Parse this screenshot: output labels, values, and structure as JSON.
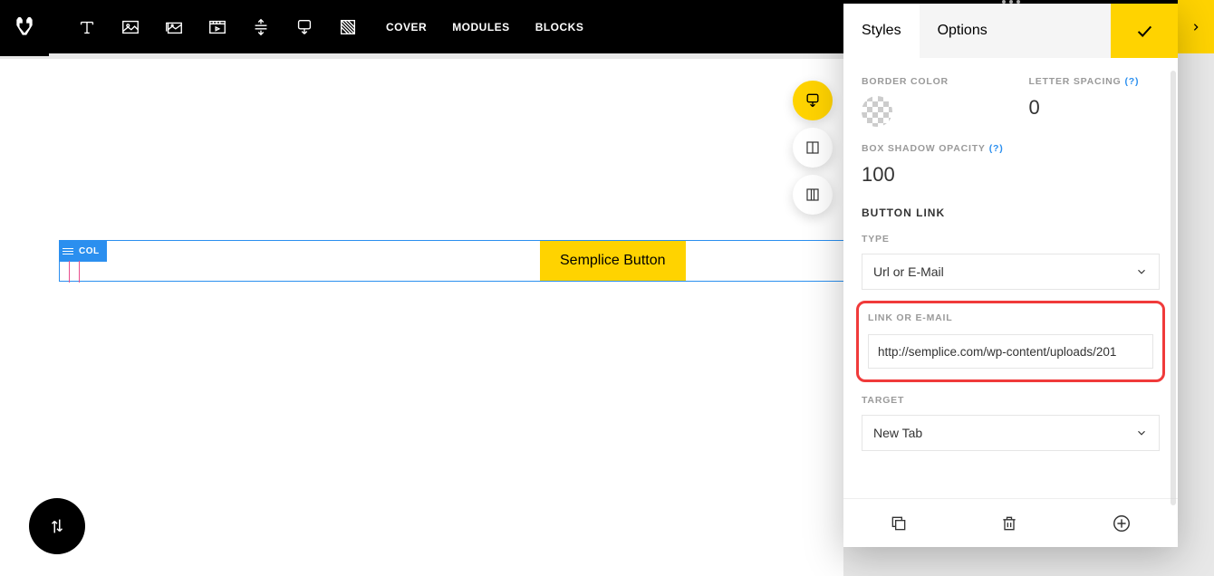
{
  "nav": {
    "cover": "COVER",
    "modules": "MODULES",
    "blocks": "BLOCKS"
  },
  "canvas": {
    "col_label": "COL",
    "button_text": "Semplice Button"
  },
  "panel": {
    "tabs": {
      "styles": "Styles",
      "options": "Options"
    },
    "border_color_label": "BORDER COLOR",
    "letter_spacing_label": "LETTER SPACING",
    "letter_spacing_value": "0",
    "box_shadow_opacity_label": "BOX SHADOW OPACITY",
    "box_shadow_opacity_value": "100",
    "help_marker": "(?)",
    "section_button_link": "BUTTON LINK",
    "type_label": "TYPE",
    "type_value": "Url or E-Mail",
    "link_label": "LINK OR E-MAIL",
    "link_value": "http://semplice.com/wp-content/uploads/201",
    "target_label": "TARGET",
    "target_value": "New Tab"
  }
}
